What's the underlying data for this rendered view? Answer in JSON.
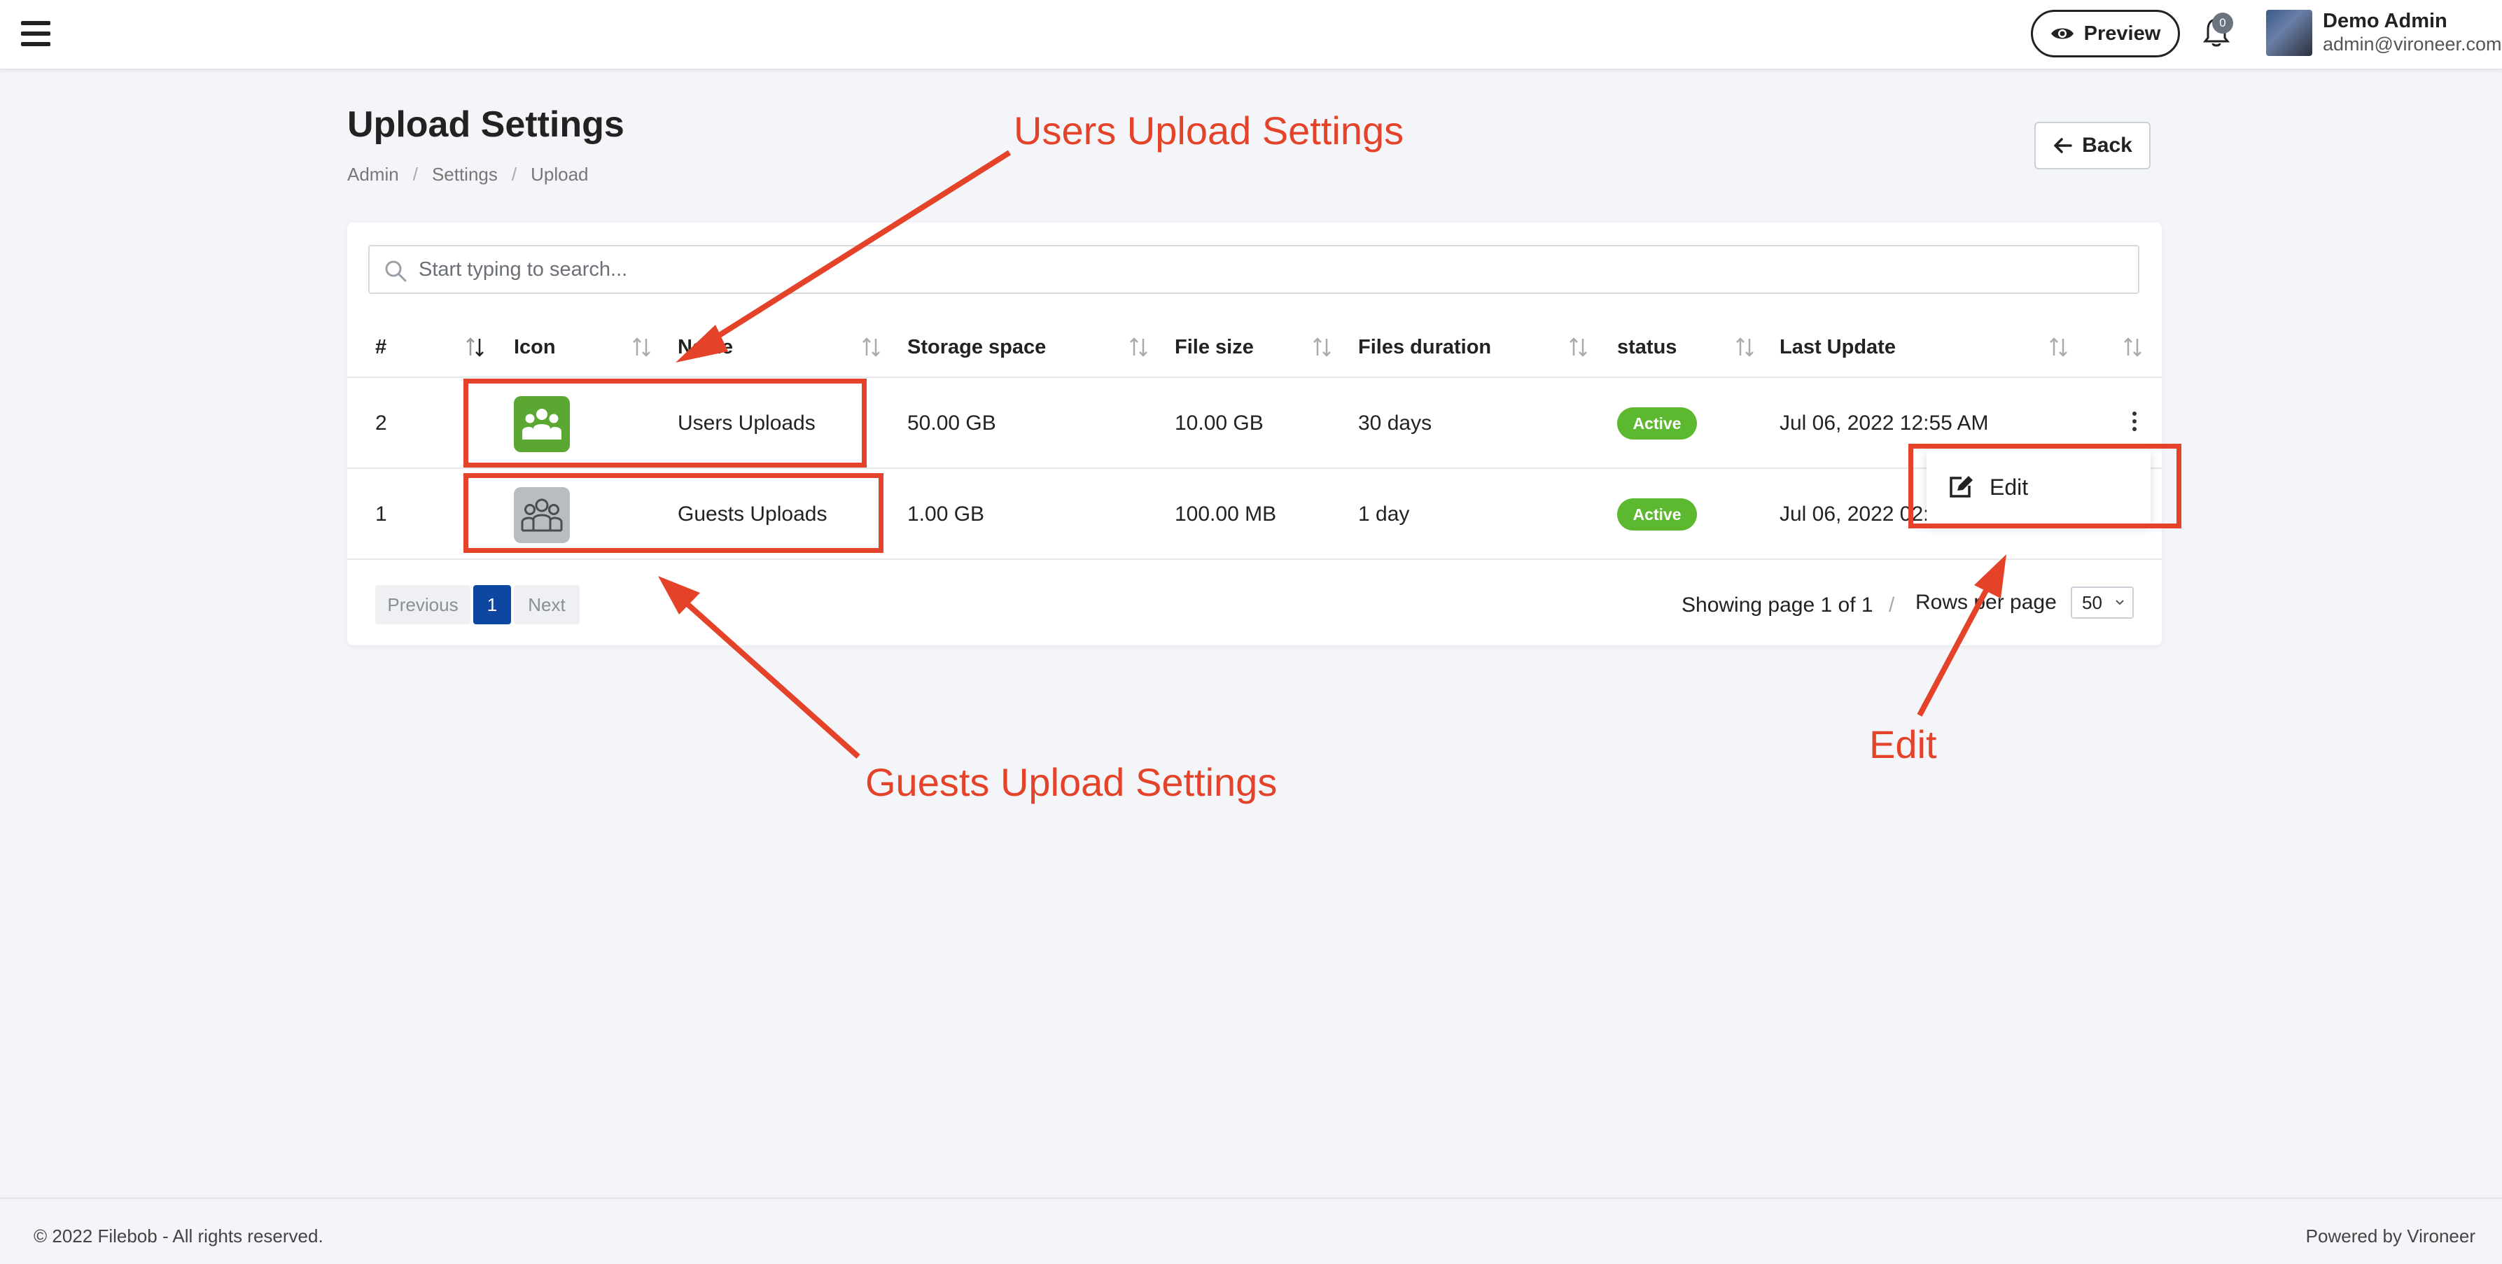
{
  "topbar": {
    "preview_label": "Preview",
    "notification_count": "0",
    "user_name": "Demo Admin",
    "user_email": "admin@vironeer.com"
  },
  "header": {
    "title": "Upload Settings",
    "breadcrumb": [
      "Admin",
      "Settings",
      "Upload"
    ],
    "back_label": "Back"
  },
  "search": {
    "placeholder": "Start typing to search..."
  },
  "table": {
    "columns": [
      "#",
      "Icon",
      "Name",
      "Storage space",
      "File size",
      "Files duration",
      "status",
      "Last Update"
    ],
    "rows": [
      {
        "id": "2",
        "name": "Users Uploads",
        "storage": "50.00 GB",
        "file_size": "10.00 GB",
        "duration": "30 days",
        "status": "Active",
        "last_update": "Jul 06, 2022 12:55 AM"
      },
      {
        "id": "1",
        "name": "Guests Uploads",
        "storage": "1.00 GB",
        "file_size": "100.00 MB",
        "duration": "1 day",
        "status": "Active",
        "last_update": "Jul 06, 2022 02:"
      }
    ]
  },
  "dropdown": {
    "edit_label": "Edit"
  },
  "pagination": {
    "previous": "Previous",
    "current": "1",
    "next": "Next",
    "showing": "Showing page 1 of 1",
    "separator": "/",
    "rows_per_page_label": "Rows per page",
    "rows_per_page_value": "50"
  },
  "annotations": {
    "users": "Users Upload Settings",
    "guests": "Guests Upload Settings",
    "edit": "Edit",
    "color": "#e5422a"
  },
  "footer": {
    "copyright": "© 2022 Filebob - All rights reserved.",
    "powered": "Powered by Vironeer"
  },
  "colors": {
    "accent": "#0d47a1",
    "active_badge": "#5cb82e",
    "users_icon": "#5aa832",
    "guests_icon": "#b9bcc1"
  }
}
